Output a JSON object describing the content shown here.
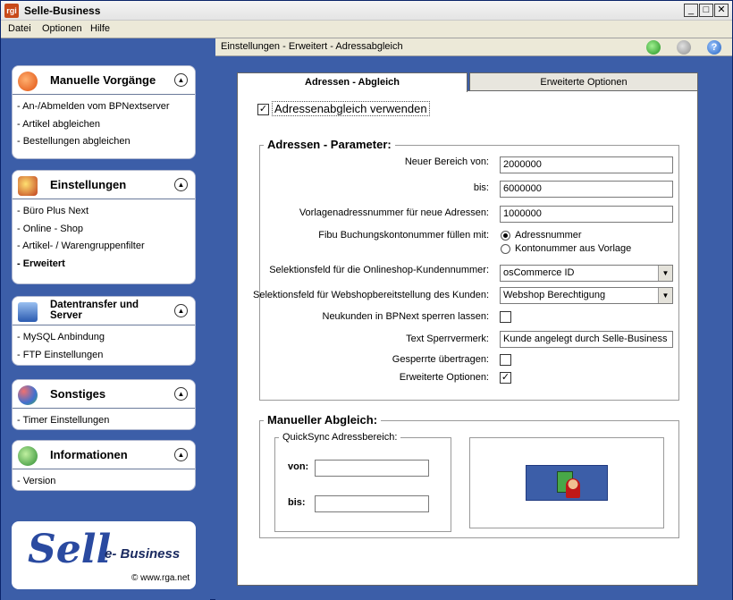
{
  "window": {
    "title": "Selle-Business",
    "icon": "app-logo-icon"
  },
  "menu": [
    "Datei",
    "Optionen",
    "Hilfe"
  ],
  "breadcrumb": "Einstellungen - Erweitert - Adressabgleich",
  "sidebar": {
    "panels": [
      {
        "title": "Manuelle Vorgänge",
        "icon": "play-icon",
        "items": [
          "- An-/Abmelden vom BPNextserver",
          "- Artikel abgleichen",
          "- Bestellungen abgleichen"
        ]
      },
      {
        "title": "Einstellungen",
        "icon": "tools-icon",
        "items": [
          "- Büro Plus Next",
          "- Online - Shop",
          "- Artikel- / Warengruppenfilter",
          "- Erweitert"
        ],
        "active": 3
      },
      {
        "title": "Datentransfer und Server",
        "icon": "server-icon",
        "items": [
          "- MySQL Anbindung",
          "- FTP Einstellungen"
        ]
      },
      {
        "title": "Sonstiges",
        "icon": "misc-icon",
        "items": [
          "- Timer Einstellungen"
        ]
      },
      {
        "title": "Informationen",
        "icon": "info-icon",
        "items": [
          "- Version"
        ]
      }
    ],
    "logo": {
      "main": "Sell",
      "sub": "e- Business",
      "url": "© www.rga.net"
    }
  },
  "tabs": [
    "Adressen - Abgleich",
    "Erweiterte Optionen"
  ],
  "form": {
    "use_checkbox_label": "Adressenabgleich verwenden",
    "params_title": "Adressen - Parameter:",
    "neuer_bereich_label": "Neuer Bereich von:",
    "neuer_bereich_value": "2000000",
    "bis_label": "bis:",
    "bis_value": "6000000",
    "vorlage_label": "Vorlagenadressnummer für neue Adressen:",
    "vorlage_value": "1000000",
    "fibu_label": "Fibu Buchungskontonummer füllen mit:",
    "fibu_opt1": "Adressnummer",
    "fibu_opt2": "Kontonummer aus Vorlage",
    "sel_kunde_label": "Selektionsfeld für die Onlineshop-Kundennummer:",
    "sel_kunde_value": "osCommerce ID",
    "sel_webshop_label": "Selektionsfeld für Webshopbereitstellung des Kunden:",
    "sel_webshop_value": "Webshop Berechtigung",
    "neukunden_label": "Neukunden in BPNext sperren lassen:",
    "sperr_label": "Text Sperrvermerk:",
    "sperr_value": "Kunde angelegt durch Selle-Business",
    "gesperrte_label": "Gesperrte übertragen:",
    "erweitert_label": "Erweiterte Optionen:",
    "manual_title": "Manueller Abgleich:",
    "quicksync_title": "QuickSync Adressbereich:",
    "von_label": "von:",
    "bis2_label": "bis:",
    "von_value": "",
    "bis2_value": ""
  }
}
